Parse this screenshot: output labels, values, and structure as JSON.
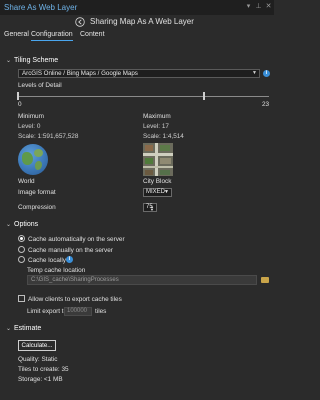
{
  "window": {
    "title": "Share As Web Layer",
    "subtitle": "Sharing Map As A Web Layer"
  },
  "tabs": [
    {
      "label": "General",
      "active": false
    },
    {
      "label": "Configuration",
      "active": true
    },
    {
      "label": "Content",
      "active": false
    }
  ],
  "tiling": {
    "heading": "Tiling Scheme",
    "scheme_value": "ArcGIS Online / Bing Maps / Google Maps",
    "levels_label": "Levels of Detail",
    "slider_min": "0",
    "slider_max": "23",
    "minimum": {
      "heading": "Minimum",
      "level": "Level:  0",
      "scale": "Scale:  1:591,657,528",
      "caption": "World"
    },
    "maximum": {
      "heading": "Maximum",
      "level": "Level:  17",
      "scale": "Scale:  1:4,514",
      "caption": "City Block"
    },
    "slider_min_level": 0,
    "slider_max_level": 17,
    "image_format_label": "Image format",
    "image_format_value": "MIXED",
    "compression_label": "Compression",
    "compression_value": "75"
  },
  "options": {
    "heading": "Options",
    "radios": [
      {
        "label": "Cache automatically on the server",
        "selected": true
      },
      {
        "label": "Cache manually on the server",
        "selected": false
      },
      {
        "label": "Cache locally",
        "selected": false
      }
    ],
    "temp_cache_label": "Temp cache location",
    "temp_cache_path": "C:\\GIS_cache\\SharingProcesses",
    "allow_export_label": "Allow clients to export cache tiles",
    "allow_export_checked": false,
    "limit_prefix": "Limit export to",
    "limit_value": "100000",
    "limit_suffix": "tiles"
  },
  "estimate": {
    "heading": "Estimate",
    "calc_button": "Calculate...",
    "quality": "Quality:  Static",
    "tiles": "Tiles to create:  35",
    "storage": "Storage:  <1 MB"
  },
  "icons": {
    "close": "close-icon",
    "pin": "pin-icon",
    "menu": "menu-icon",
    "back": "back-arrow-icon",
    "info": "info-icon",
    "folder": "folder-icon"
  },
  "colors": {
    "background": "#2b2b2b",
    "accent": "#4aa6ee",
    "title": "#6fb3e8"
  }
}
